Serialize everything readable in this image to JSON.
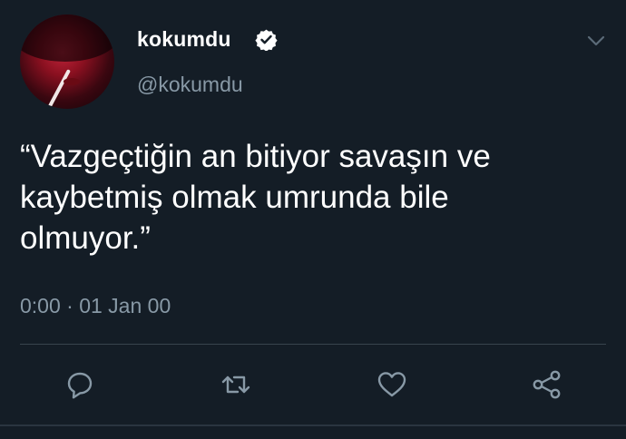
{
  "user": {
    "display_name": "kokumdu",
    "handle": "@kokumdu",
    "verified": true
  },
  "tweet": {
    "text_lines": [
      "“Vazgeçtiğin an bitiyor savaşın ve",
      "kaybetmiş olmak umrunda bile",
      "olmuyor.”"
    ],
    "timestamp": "0:00 · 01 Jan 00"
  },
  "actions": [
    {
      "icon": "reply-icon"
    },
    {
      "icon": "retweet-icon"
    },
    {
      "icon": "like-icon"
    },
    {
      "icon": "share-icon"
    }
  ],
  "colors": {
    "background": "#141d26",
    "primary_text": "#ffffff",
    "secondary_text": "#8899a6",
    "divider": "#38444d"
  }
}
